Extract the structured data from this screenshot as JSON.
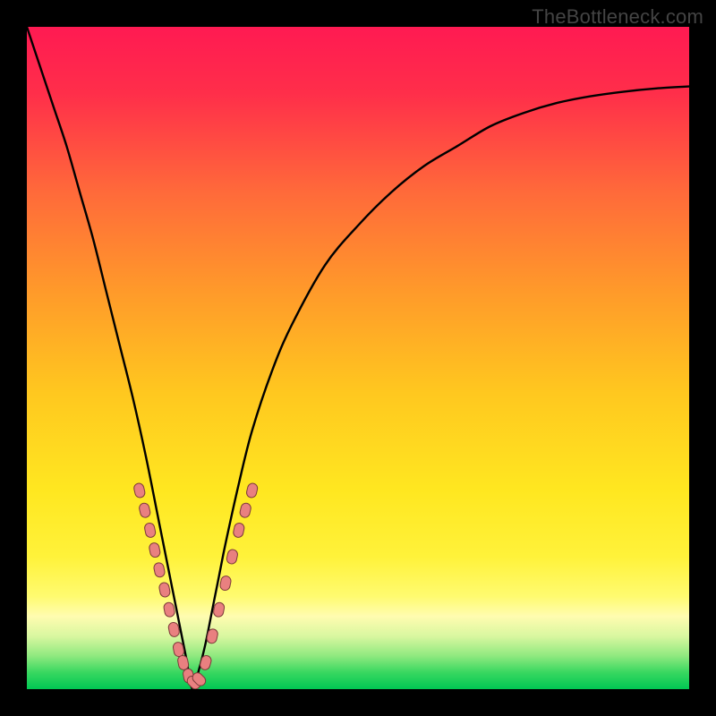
{
  "watermark": "TheBottleneck.com",
  "colors": {
    "frame": "#000000",
    "gradient_stops": [
      {
        "offset": 0.0,
        "color": "#ff1a52"
      },
      {
        "offset": 0.1,
        "color": "#ff2e4a"
      },
      {
        "offset": 0.25,
        "color": "#ff6a3a"
      },
      {
        "offset": 0.4,
        "color": "#ff9a2a"
      },
      {
        "offset": 0.55,
        "color": "#ffc71f"
      },
      {
        "offset": 0.7,
        "color": "#ffe720"
      },
      {
        "offset": 0.8,
        "color": "#fff23a"
      },
      {
        "offset": 0.86,
        "color": "#fffb70"
      },
      {
        "offset": 0.89,
        "color": "#fffcb0"
      },
      {
        "offset": 0.92,
        "color": "#d9f7a0"
      },
      {
        "offset": 0.95,
        "color": "#8fe97f"
      },
      {
        "offset": 0.975,
        "color": "#38d760"
      },
      {
        "offset": 1.0,
        "color": "#00c853"
      }
    ],
    "curve": "#000000",
    "bead_fill": "#e98080",
    "bead_stroke": "#7d3a3a"
  },
  "chart_data": {
    "type": "line",
    "title": "",
    "xlabel": "",
    "ylabel": "",
    "xlim": [
      0,
      100
    ],
    "ylim": [
      0,
      100
    ],
    "note": "Axes are unlabeled; values are relative percentages of the plot area. y is a V-shaped bottleneck curve reaching ~0 near x≈25.",
    "series": [
      {
        "name": "bottleneck-curve",
        "x": [
          0,
          2,
          4,
          6,
          8,
          10,
          12,
          14,
          16,
          18,
          20,
          21,
          22,
          23,
          24,
          25,
          26,
          27,
          28,
          29,
          30,
          32,
          34,
          37,
          40,
          45,
          50,
          55,
          60,
          65,
          70,
          75,
          80,
          85,
          90,
          95,
          100
        ],
        "y": [
          100,
          94,
          88,
          82,
          75,
          68,
          60,
          52,
          44,
          35,
          25,
          20,
          15,
          10,
          5,
          0,
          3,
          7,
          12,
          17,
          22,
          31,
          39,
          48,
          55,
          64,
          70,
          75,
          79,
          82,
          85,
          87,
          88.5,
          89.5,
          90.2,
          90.7,
          91
        ]
      }
    ],
    "beads": {
      "name": "pink-beads",
      "note": "Clusters of capsule-shaped markers along both branches near the bottom of the V.",
      "points": [
        {
          "x": 17.0,
          "y": 30
        },
        {
          "x": 17.8,
          "y": 27
        },
        {
          "x": 18.6,
          "y": 24
        },
        {
          "x": 19.3,
          "y": 21
        },
        {
          "x": 20.0,
          "y": 18
        },
        {
          "x": 20.8,
          "y": 15
        },
        {
          "x": 21.5,
          "y": 12
        },
        {
          "x": 22.2,
          "y": 9
        },
        {
          "x": 22.9,
          "y": 6
        },
        {
          "x": 23.6,
          "y": 4
        },
        {
          "x": 24.4,
          "y": 2
        },
        {
          "x": 25.2,
          "y": 1
        },
        {
          "x": 26.0,
          "y": 1.5
        },
        {
          "x": 27.0,
          "y": 4
        },
        {
          "x": 28.0,
          "y": 8
        },
        {
          "x": 29.0,
          "y": 12
        },
        {
          "x": 30.0,
          "y": 16
        },
        {
          "x": 31.0,
          "y": 20
        },
        {
          "x": 32.0,
          "y": 24
        },
        {
          "x": 33.0,
          "y": 27
        },
        {
          "x": 34.0,
          "y": 30
        }
      ]
    }
  }
}
